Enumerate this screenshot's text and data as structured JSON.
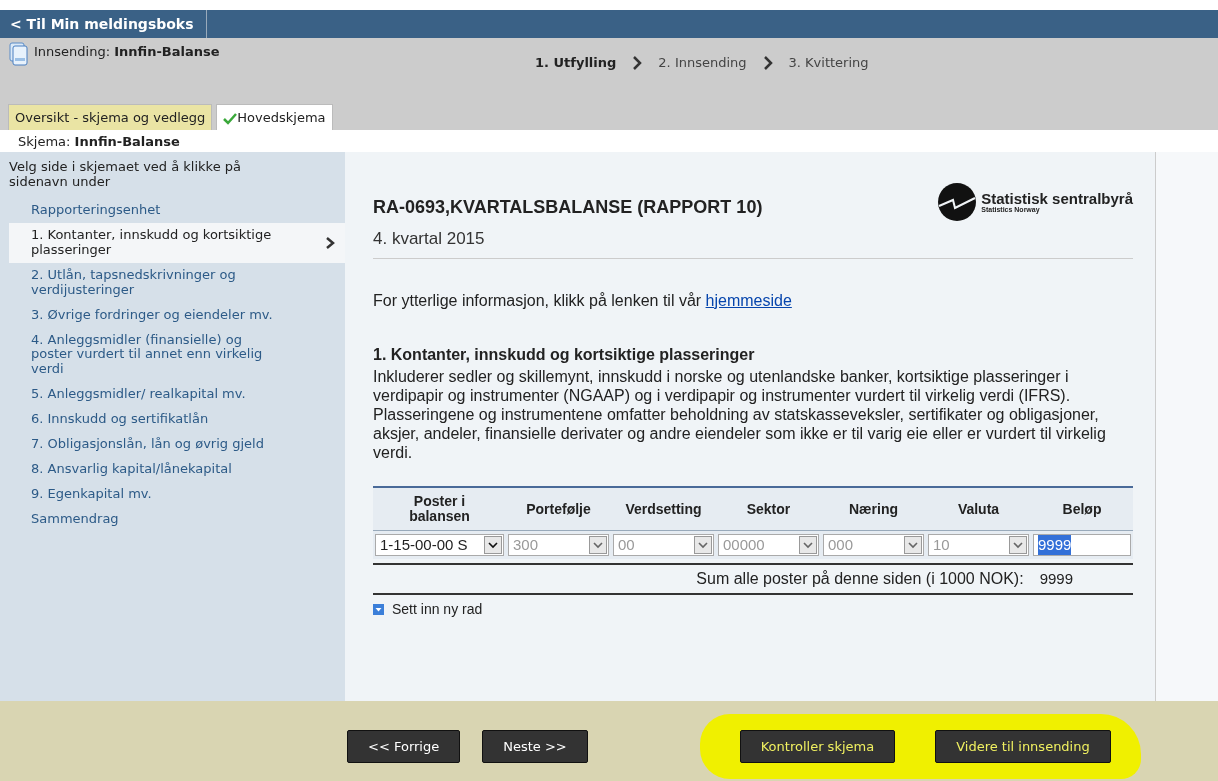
{
  "top_bar": {
    "back_link": "< Til Min meldingsboks"
  },
  "header": {
    "label": "Innsending:",
    "value": "Innfin-Balanse",
    "steps": [
      {
        "label": "1. Utfylling",
        "selected": true
      },
      {
        "label": "2. Innsending",
        "selected": false
      },
      {
        "label": "3. Kvittering",
        "selected": false
      }
    ],
    "tabs": [
      {
        "label": "Oversikt - skjema og vedlegg",
        "selected": false,
        "checked": false
      },
      {
        "label": "Hovedskjema",
        "selected": true,
        "checked": true
      }
    ]
  },
  "form_line": {
    "label": "Skjema:",
    "value": "Innfin-Balanse"
  },
  "sidebar": {
    "instruction": "Velg side i skjemaet ved å klikke på sidenavn under",
    "items": [
      {
        "label": "Rapporteringsenhet",
        "selected": false
      },
      {
        "label": "1. Kontanter, innskudd og kortsiktige plasseringer",
        "selected": true
      },
      {
        "label": "2. Utlån, tapsnedskrivninger og verdijusteringer",
        "selected": false
      },
      {
        "label": "3. Øvrige fordringer og eiendeler mv.",
        "selected": false
      },
      {
        "label": "4. Anleggsmidler (finansielle) og poster vurdert til annet enn virkelig verdi",
        "selected": false
      },
      {
        "label": "5. Anleggsmidler/ realkapital mv.",
        "selected": false
      },
      {
        "label": "6. Innskudd og sertifikatlån",
        "selected": false
      },
      {
        "label": "7. Obligasjonslån, lån og øvrig gjeld",
        "selected": false
      },
      {
        "label": "8. Ansvarlig kapital/lånekapital",
        "selected": false
      },
      {
        "label": "9. Egenkapital mv.",
        "selected": false
      },
      {
        "label": "Sammendrag",
        "selected": false
      }
    ]
  },
  "content": {
    "title": "RA-0693,KVARTALSBALANSE (RAPPORT 10)",
    "period": "4. kvartal 2015",
    "logo": {
      "name": "Statistisk sentralbyrå",
      "subtitle": "Statistics Norway"
    },
    "info": {
      "text": "For ytterlige informasjon, klikk på lenken til vår",
      "link": "hjemmeside"
    },
    "section_title": "1. Kontanter, innskudd og kortsiktige plasseringer",
    "section_text": "Inkluderer sedler og skillemynt, innskudd i norske og utenlandske banker, kortsiktige plasseringer i verdipapir og instrumenter (NGAAP) og i verdipapir og instrumenter vurdert til virkelig verdi (IFRS). Plasseringene og instrumentene omfatter beholdning av statskasseveksler, sertifikater og obligasjoner, aksjer, andeler, finansielle derivater og andre eiendeler som ikke er til varig eie eller er vurdert til virkelig verdi.",
    "table": {
      "columns": [
        "Poster i balansen",
        "Portefølje",
        "Verdsetting",
        "Sektor",
        "Næring",
        "Valuta",
        "Beløp"
      ],
      "rows": [
        {
          "cells": [
            {
              "kind": "select",
              "value": "1-15-00-00 S",
              "disabled": false
            },
            {
              "kind": "select",
              "value": "300",
              "disabled": true
            },
            {
              "kind": "select",
              "value": "00",
              "disabled": true
            },
            {
              "kind": "select",
              "value": "00000",
              "disabled": true
            },
            {
              "kind": "select",
              "value": "000",
              "disabled": true
            },
            {
              "kind": "select",
              "value": "10",
              "disabled": true
            },
            {
              "kind": "input",
              "value": "9999",
              "selected": true
            }
          ]
        }
      ],
      "sum_label": "Sum alle poster på denne siden (i 1000 NOK):",
      "sum_value": "9999"
    },
    "insert_row": "Sett inn ny rad"
  },
  "footer": {
    "buttons": [
      {
        "label": "<< Forrige",
        "highlighted": false
      },
      {
        "label": "Neste >>",
        "highlighted": false
      },
      {
        "label": "Kontroller skjema",
        "highlighted": true
      },
      {
        "label": "Videre til innsending",
        "highlighted": true
      }
    ]
  }
}
